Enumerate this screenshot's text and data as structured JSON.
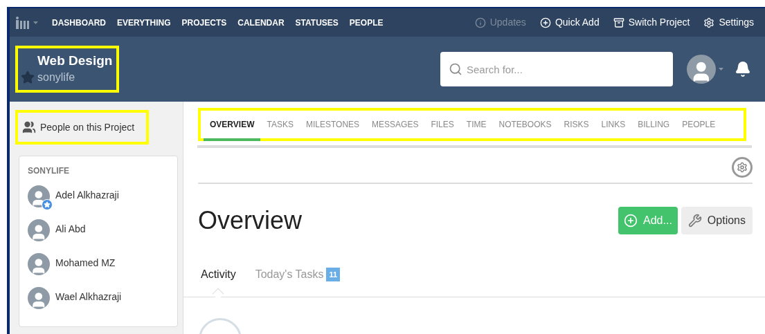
{
  "top_nav": {
    "items": [
      {
        "label": "DASHBOARD"
      },
      {
        "label": "EVERYTHING"
      },
      {
        "label": "PROJECTS"
      },
      {
        "label": "CALENDAR"
      },
      {
        "label": "STATUSES"
      },
      {
        "label": "PEOPLE"
      }
    ],
    "actions": [
      {
        "kind": "info",
        "label": "Updates",
        "disabled": true
      },
      {
        "kind": "add",
        "label": "Quick Add",
        "disabled": false
      },
      {
        "kind": "switch",
        "label": "Switch Project",
        "disabled": false
      },
      {
        "kind": "settings",
        "label": "Settings",
        "disabled": false
      }
    ]
  },
  "project": {
    "title": "Web Design",
    "company": "sonylife",
    "starred": false
  },
  "search": {
    "placeholder": "Search for..."
  },
  "sidebar": {
    "title": "People on this Project",
    "group": "SONYLIFE",
    "people": [
      {
        "name": "Adel Alkhazraji",
        "starred": true
      },
      {
        "name": "Ali Abd",
        "starred": false
      },
      {
        "name": "Mohamed MZ",
        "starred": false
      },
      {
        "name": "Wael Alkhazraji",
        "starred": false
      }
    ]
  },
  "tabs": [
    {
      "label": "OVERVIEW",
      "selected": true
    },
    {
      "label": "TASKS",
      "selected": false
    },
    {
      "label": "MILESTONES",
      "selected": false
    },
    {
      "label": "MESSAGES",
      "selected": false
    },
    {
      "label": "FILES",
      "selected": false
    },
    {
      "label": "TIME",
      "selected": false
    },
    {
      "label": "NOTEBOOKS",
      "selected": false
    },
    {
      "label": "RISKS",
      "selected": false
    },
    {
      "label": "LINKS",
      "selected": false
    },
    {
      "label": "BILLING",
      "selected": false
    },
    {
      "label": "PEOPLE",
      "selected": false
    }
  ],
  "page": {
    "title": "Overview",
    "buttons": [
      {
        "kind": "add",
        "label": "Add..."
      },
      {
        "kind": "options",
        "label": "Options"
      }
    ]
  },
  "subtabs": [
    {
      "label": "Activity",
      "selected": true
    },
    {
      "label": "Today's Tasks",
      "selected": false,
      "badge": "11"
    }
  ]
}
